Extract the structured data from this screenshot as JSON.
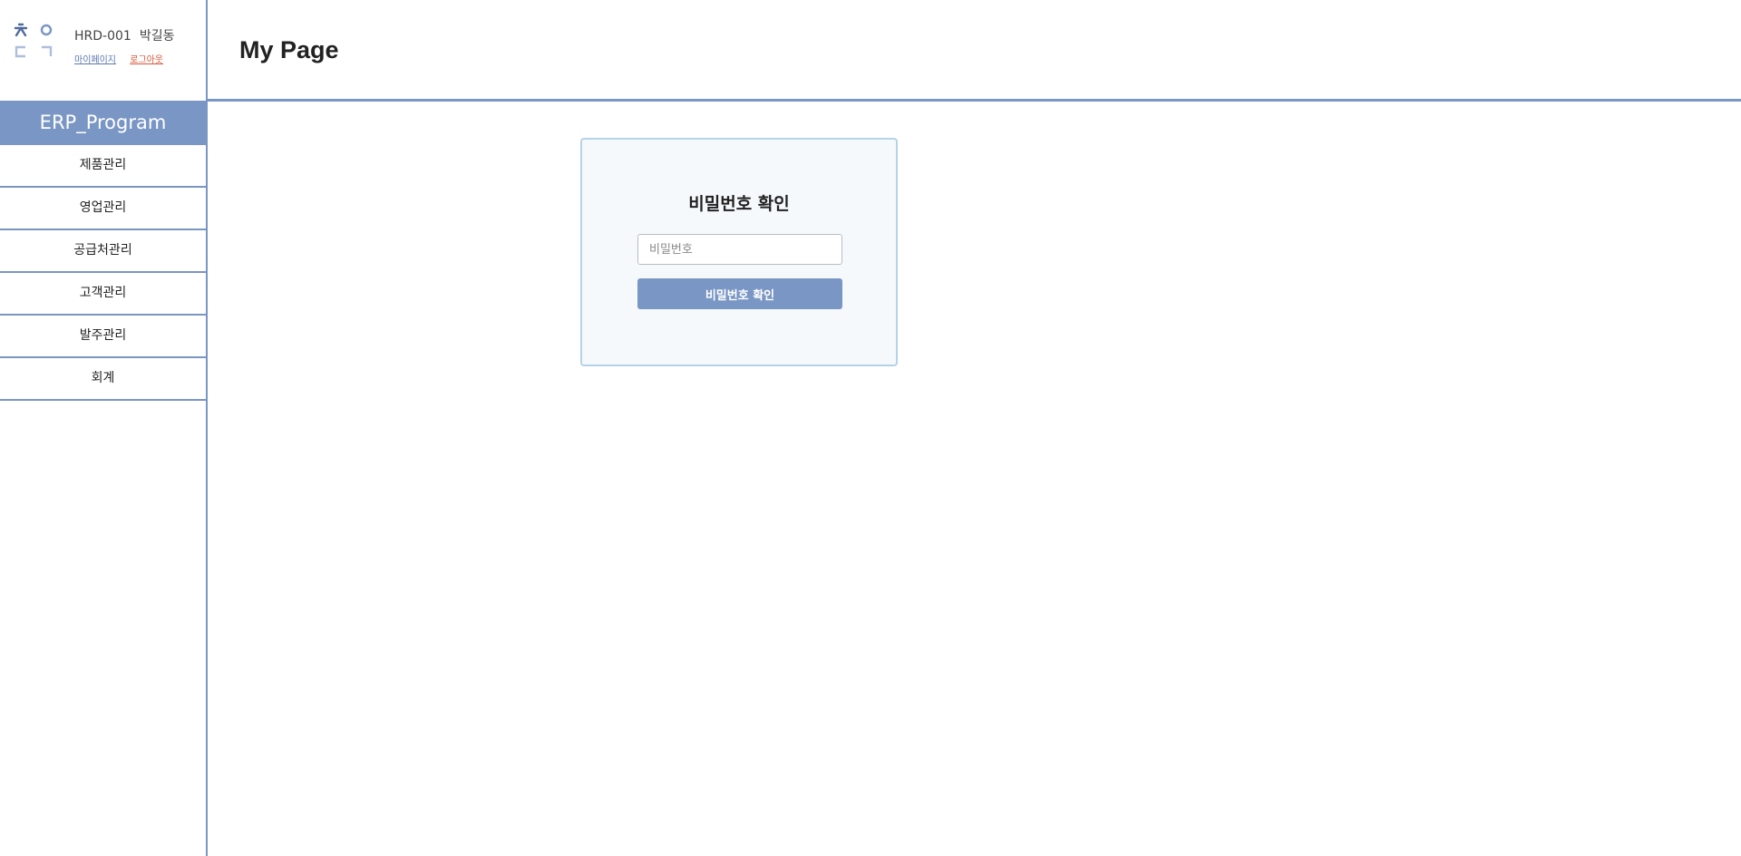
{
  "sidebar": {
    "user": {
      "id": "HRD-001",
      "name": "박길동",
      "mypage_link": "마이페이지",
      "logout_link": "로그아웃"
    },
    "brand": "ERP_Program",
    "menu": [
      {
        "label": "제품관리"
      },
      {
        "label": "영업관리"
      },
      {
        "label": "공급처관리"
      },
      {
        "label": "고객관리"
      },
      {
        "label": "발주관리"
      },
      {
        "label": "회계"
      }
    ]
  },
  "header": {
    "title": "My Page"
  },
  "password_card": {
    "title": "비밀번호 확인",
    "input_placeholder": "비밀번호",
    "input_value": "",
    "button_label": "비밀번호 확인"
  },
  "colors": {
    "accent": "#7a96c4",
    "card_border": "#b5d3e6",
    "card_bg": "#f5f9fb",
    "logout_link": "#d9573a",
    "mypage_link": "#5b78b1"
  },
  "icons": {
    "logo": "hangul-initials-logo"
  }
}
